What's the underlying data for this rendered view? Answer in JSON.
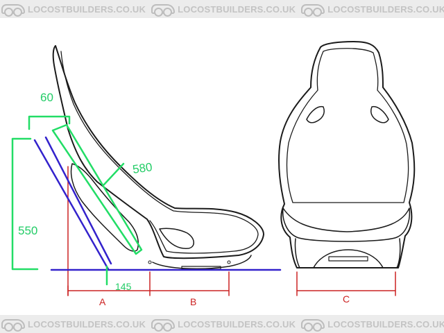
{
  "watermark": {
    "text": "LOCOSTBUILDERS.CO.UK",
    "icon": "car-logo-icon"
  },
  "dimensions": {
    "top_width": "60",
    "back_length": "580",
    "back_height": "550",
    "base_offset": "145",
    "label_a": "A",
    "label_b": "B",
    "label_c": "C"
  },
  "colors": {
    "outline": "#1a1a1a",
    "red": "#cc2222",
    "green": "#22dd66",
    "blue": "#3322cc",
    "watermark_band": "#ececec",
    "watermark_text": "#c3c3c3"
  }
}
